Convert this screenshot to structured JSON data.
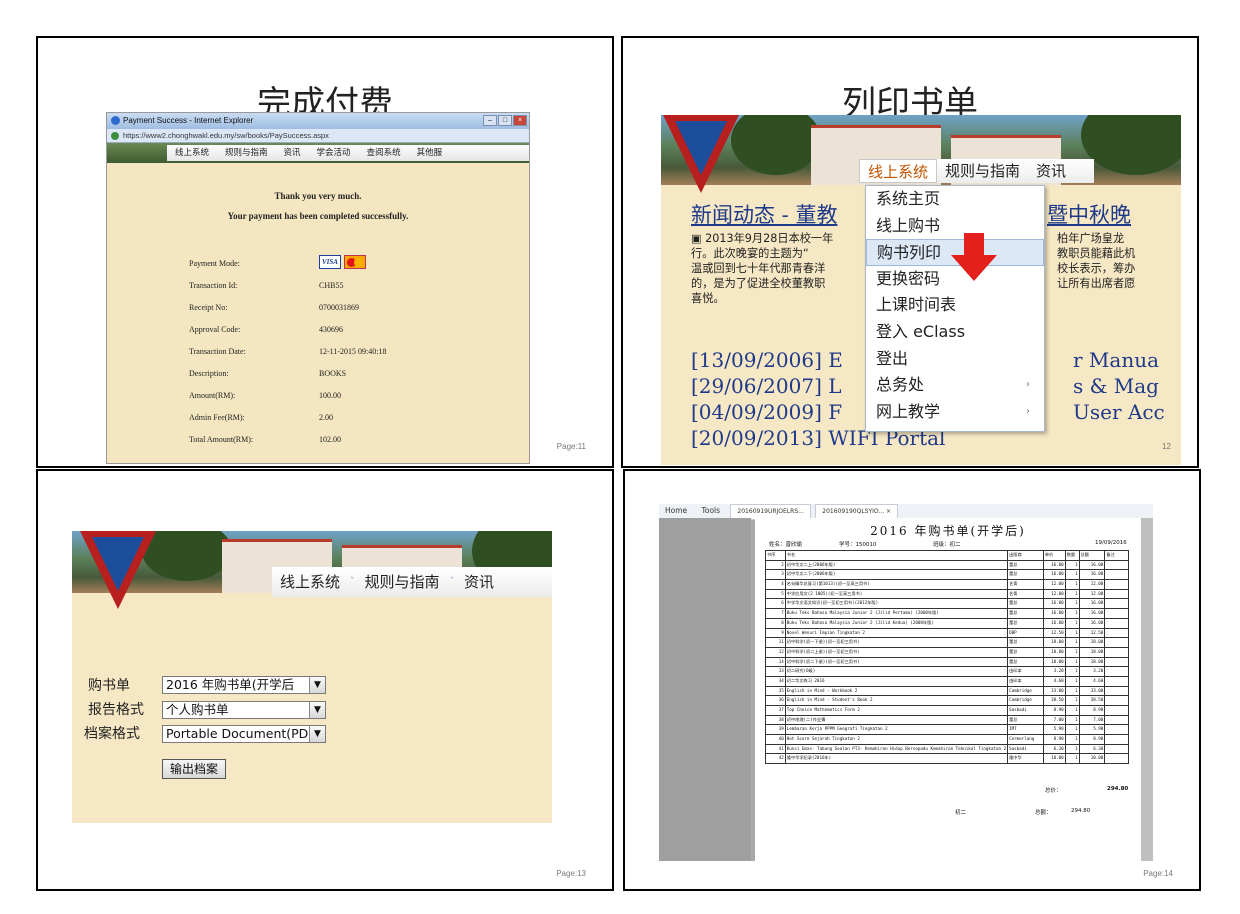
{
  "slide1": {
    "title": "完成付费",
    "page": "Page:11",
    "window_title": "Payment Success - Internet Explorer",
    "url": "https://www2.chonghwakl.edu.my/sw/books/PaySuccess.aspx",
    "menu": [
      "线上系统",
      "规则与指南",
      "资讯",
      "学会活动",
      "查阅系统",
      "其他服"
    ],
    "thanks": "Thank you very much.",
    "success": "Your payment has been completed successfully.",
    "rows": [
      {
        "label": "Payment Mode:",
        "value": ""
      },
      {
        "label": "Transaction Id:",
        "value": "CHB55"
      },
      {
        "label": "Receipt No:",
        "value": "0700031869"
      },
      {
        "label": "Approval Code:",
        "value": "430696"
      },
      {
        "label": "Transaction Date:",
        "value": "12-11-2015 09:40:18"
      },
      {
        "label": "Description:",
        "value": "BOOKS"
      },
      {
        "label": "Amount(RM):",
        "value": "100.00"
      },
      {
        "label": "Admin Fee(RM):",
        "value": "2.00"
      },
      {
        "label": "Total Amount(RM):",
        "value": "102.00"
      }
    ],
    "card_visa": "VISA"
  },
  "slide2": {
    "title": "列印书单",
    "page": "12",
    "menu": [
      "线上系统",
      "规则与指南",
      "资讯"
    ],
    "dropdown": [
      "系统主页",
      "线上购书",
      "购书列印",
      "更换密码",
      "上课时间表",
      "登入 eClass",
      "登出",
      "总务处",
      "网上教学"
    ],
    "highlighted": 2,
    "news_title": "新闻动态 - 董教",
    "news_title_right": "暨中秋晚",
    "news_lines": [
      "2013年9月28日本校一年",
      "行。此次晚宴的主题为“",
      "温或回到七十年代那青春洋",
      "的，是为了促进全校董教职",
      "喜悦。"
    ],
    "news_lines_right": [
      "柏年广场皇龙",
      "教职员能藉此机",
      "校长表示，筹办",
      "让所有出席者愿",
      ""
    ],
    "links": [
      "[13/09/2006] E",
      "[29/06/2007] L",
      "[04/09/2009] F",
      "[20/09/2013] WIFI Portal"
    ],
    "links_right": [
      "r Manua",
      "s & Mag",
      "User Acc",
      ""
    ]
  },
  "slide3": {
    "page": "Page:13",
    "menu": [
      "线上系统",
      "规则与指南",
      "资讯"
    ],
    "fields": [
      {
        "label": "购书单",
        "value": "2016 年购书单(开学后"
      },
      {
        "label": "报告格式",
        "value": "个人购书单"
      },
      {
        "label": "档案格式",
        "value": "Portable Document(PDF)"
      }
    ],
    "button": "输出档案"
  },
  "slide4": {
    "page": "Page:14",
    "toolbar": [
      "Home",
      "Tools"
    ],
    "tabs": [
      "20160919URJOELRS...",
      "201609190QLSYIO...  ×"
    ],
    "doc_title": "2016 年购书单(开学后)",
    "name_label": "姓名：曾欣瑜",
    "id_label": "学号：150010",
    "class_label": "班级：初二",
    "date": "19/09/2016",
    "headers": [
      "书序",
      "书名",
      "出版商",
      "单价",
      "数量",
      "总额",
      "备注"
    ],
    "books": [
      [
        "2",
        "初中华文二上(2006年版)",
        "董总",
        "16.00",
        "1",
        "16.00"
      ],
      [
        "3",
        "初中华文二下(2006年版)",
        "董总",
        "16.00",
        "1",
        "16.00"
      ],
      [
        "4",
        "名句精华总复习(第1013)(初一至高三用书)",
        "艺青",
        "12.00",
        "1",
        "12.00"
      ],
      [
        "5",
        "中学应用文(2 1005)(初一至高三用书)",
        "艺青",
        "12.00",
        "1",
        "12.00"
      ],
      [
        "6",
        "中学华文语文知识(初一至初三用书)(2012年版)",
        "董总",
        "16.00",
        "1",
        "16.00"
      ],
      [
        "7",
        "Buku Teks Bahasa Malaysia Junior 2 (Jilid Pertama) (2008年版)",
        "董总",
        "16.00",
        "1",
        "16.00"
      ],
      [
        "8",
        "Buku Teks Bahasa Malaysia Junior 2 (Jilid Kedua) (2008年版)",
        "董总",
        "16.00",
        "1",
        "16.00"
      ],
      [
        "9",
        "Novel Wenuri Impian Tingkatan 2",
        "DBP",
        "12.50",
        "1",
        "12.50"
      ],
      [
        "11",
        "初中科学(初一下册)(初一至初三用书)",
        "董总",
        "18.00",
        "1",
        "18.00"
      ],
      [
        "12",
        "初中科学(初二上册)(初一至初三用书)",
        "董总",
        "18.00",
        "1",
        "18.00"
      ],
      [
        "14",
        "初中科学(初二下册)(初一至初三用书)",
        "董总",
        "18.00",
        "1",
        "18.00"
      ],
      [
        "33",
        "初二研究(O级)",
        "由印本",
        "3.20",
        "1",
        "3.20"
      ],
      [
        "34",
        "初二华文练习 2016",
        "由印本",
        "4.60",
        "1",
        "4.60"
      ],
      [
        "35",
        "English in Mind - Workbook 2",
        "Cambridge",
        "33.00",
        "1",
        "33.00"
      ],
      [
        "36",
        "English in Mind - Student's Book 2",
        "Cambridge",
        "38.50",
        "1",
        "38.50"
      ],
      [
        "37",
        "Top Choice Mathematics Form 2",
        "Sasbadi",
        "8.90",
        "1",
        "8.90"
      ],
      [
        "38",
        "初中地理(二)作业簿",
        "董总",
        "7.00",
        "1",
        "7.00"
      ],
      [
        "39",
        "Lembaran Kerja PPPM Geografi Tingkatan 2",
        "IMT",
        "5.90",
        "1",
        "5.90"
      ],
      [
        "40",
        "Hot Score Sejarah Tingkatan 2",
        "Cermerlang",
        "8.90",
        "1",
        "8.90"
      ],
      [
        "41",
        "Kunci Emas- Tabung Soalan PT3- Kemahiran Hidup Bersepadu Kemahiran Teknikal Tingkatan 2",
        "Sasbadi",
        "6.30",
        "1",
        "6.30"
      ],
      [
        "42",
        "隆中华学纪录(2016年)",
        "隆中华",
        "10.00",
        "1",
        "10.00"
      ]
    ],
    "total_label": "总价：",
    "total": "294.80",
    "footer_class": "初二",
    "footer_total_label": "总额：",
    "footer_total": "294.80"
  }
}
